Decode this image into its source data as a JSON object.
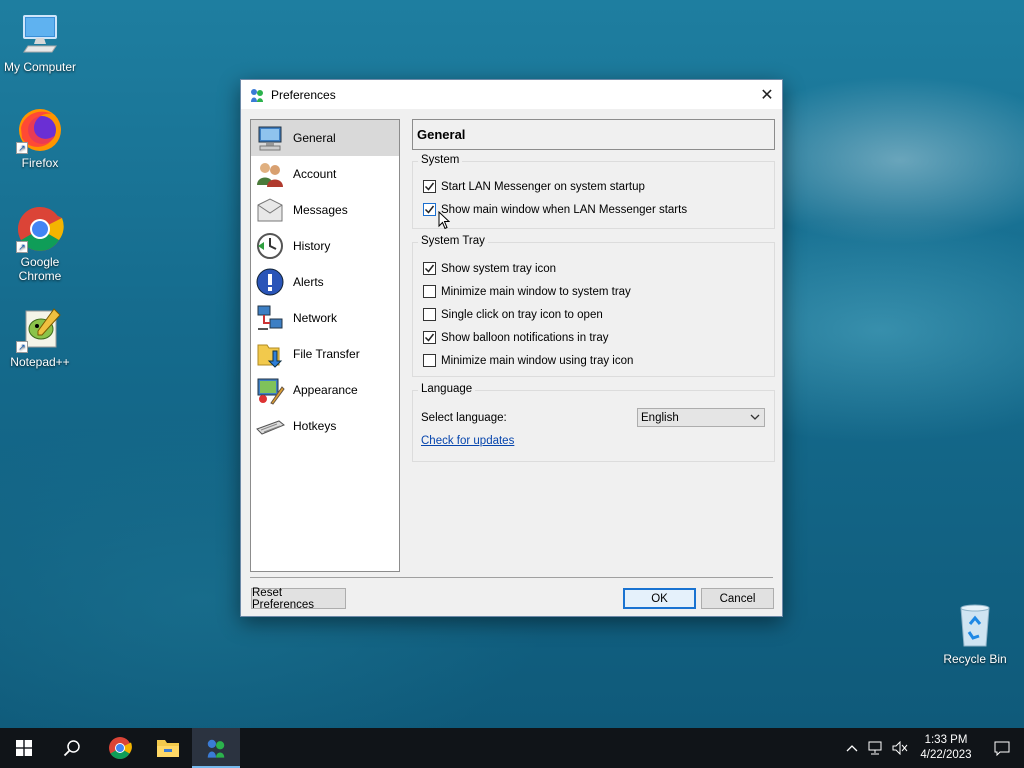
{
  "desktop": {
    "icons": [
      {
        "label": "My Computer"
      },
      {
        "label": "Firefox"
      },
      {
        "label": "Google Chrome"
      },
      {
        "label": "Notepad++"
      },
      {
        "label": "Recycle Bin"
      }
    ]
  },
  "window": {
    "title": "Preferences",
    "close_glyph": "✕",
    "nav": [
      {
        "label": "General",
        "icon": "computer-icon",
        "selected": true
      },
      {
        "label": "Account",
        "icon": "users-icon"
      },
      {
        "label": "Messages",
        "icon": "envelope-icon"
      },
      {
        "label": "History",
        "icon": "clock-icon"
      },
      {
        "label": "Alerts",
        "icon": "alert-icon"
      },
      {
        "label": "Network",
        "icon": "network-icon"
      },
      {
        "label": "File Transfer",
        "icon": "folder-transfer-icon"
      },
      {
        "label": "Appearance",
        "icon": "appearance-icon"
      },
      {
        "label": "Hotkeys",
        "icon": "keyboard-icon"
      }
    ],
    "page_title": "General",
    "system": {
      "title": "System",
      "options": [
        {
          "label": "Start LAN Messenger on system startup",
          "checked": true
        },
        {
          "label": "Show main window when LAN Messenger starts",
          "checked": true
        }
      ]
    },
    "tray": {
      "title": "System Tray",
      "options": [
        {
          "label": "Show system tray icon",
          "checked": true
        },
        {
          "label": "Minimize main window to system tray",
          "checked": false
        },
        {
          "label": "Single click on tray icon to open",
          "checked": false
        },
        {
          "label": "Show balloon notifications in tray",
          "checked": true
        },
        {
          "label": "Minimize main window using tray icon",
          "checked": false
        }
      ]
    },
    "language": {
      "title": "Language",
      "select_label": "Select language:",
      "selected": "English",
      "update_link": "Check for updates"
    },
    "buttons": {
      "reset": "Reset Preferences",
      "ok": "OK",
      "cancel": "Cancel"
    }
  },
  "taskbar": {
    "time": "1:33 PM",
    "date": "4/22/2023"
  },
  "colors": {
    "accent": "#1a73d1",
    "taskbar": "#101418",
    "link": "#0645ad"
  }
}
